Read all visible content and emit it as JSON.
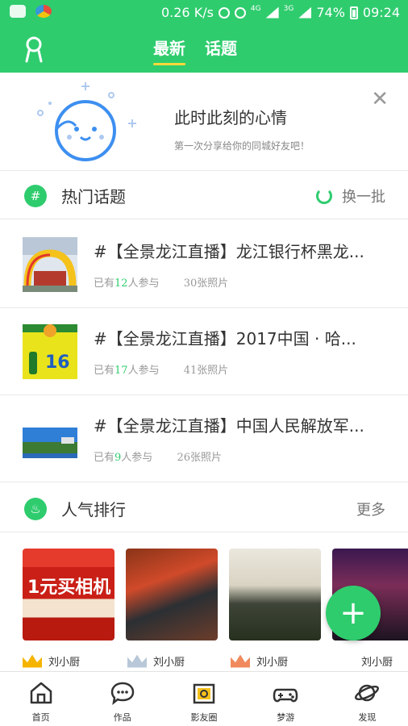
{
  "status_bar": {
    "speed": "0.26 K/s",
    "net1": "4G",
    "net2": "3G",
    "battery": "74%",
    "time": "09:24"
  },
  "header": {
    "tabs": [
      {
        "label": "最新",
        "active": true
      },
      {
        "label": "话题",
        "active": false
      }
    ]
  },
  "mood_card": {
    "title": "此时此刻的心情",
    "subtitle": "第一次分享给你的同城好友吧！",
    "close": "✕"
  },
  "hot_topics": {
    "title": "热门话题",
    "action": "换一批",
    "items": [
      {
        "title": "#【全景龙江直播】龙江银行杯黑龙...",
        "participants_prefix": "已有",
        "participants": "12",
        "participants_suffix": "人参与",
        "photos": "30张照片"
      },
      {
        "title": "#【全景龙江直播】2017中国 · 哈...",
        "participants_prefix": "已有",
        "participants": "17",
        "participants_suffix": "人参与",
        "photos": "41张照片"
      },
      {
        "title": "#【全景龙江直播】中国人民解放军...",
        "participants_prefix": "已有",
        "participants": "9",
        "participants_suffix": "人参与",
        "photos": "26张照片"
      }
    ]
  },
  "popular": {
    "title": "人气排行",
    "action": "更多",
    "promo_text": "1元买相机",
    "users": [
      "刘小厨",
      "刘小厨",
      "刘小厨",
      "刘小厨"
    ],
    "crown_colors": [
      "#f5b400",
      "#b8c8d8",
      "#f08a5d"
    ]
  },
  "fab": "+",
  "bottom_nav": [
    "首页",
    "作品",
    "影友圈",
    "梦游",
    "发现"
  ],
  "colors": {
    "accent": "#2fcc6e",
    "tab_underline": "#ffd83a"
  }
}
